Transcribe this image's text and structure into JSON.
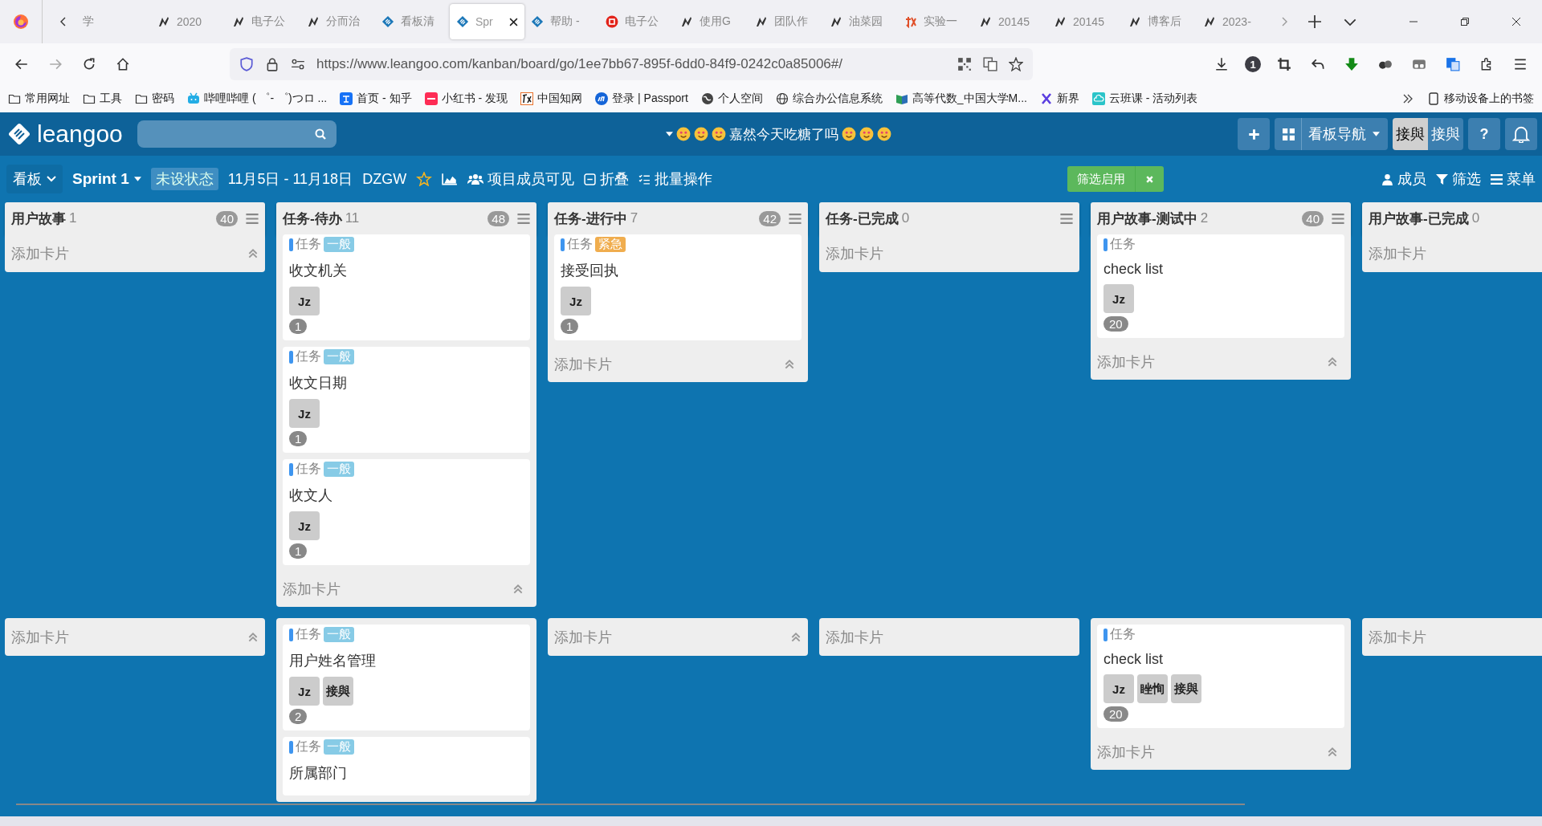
{
  "browser": {
    "tabs": [
      {
        "title": "学",
        "kind": "none",
        "selected": false
      },
      {
        "title": "2020",
        "kind": "bird",
        "selected": false
      },
      {
        "title": "电子公",
        "kind": "bird",
        "selected": false
      },
      {
        "title": "分而治",
        "kind": "bird",
        "selected": false
      },
      {
        "title": "看板清",
        "kind": "diamond",
        "selected": false
      },
      {
        "title": "Spr",
        "kind": "diamond",
        "selected": true
      },
      {
        "title": "帮助 -",
        "kind": "diamond",
        "selected": false
      },
      {
        "title": "电子公",
        "kind": "ring",
        "selected": false
      },
      {
        "title": "使用G",
        "kind": "bird",
        "selected": false
      },
      {
        "title": "团队作",
        "kind": "bird",
        "selected": false
      },
      {
        "title": "油菜园",
        "kind": "bird",
        "selected": false
      },
      {
        "title": "实验一",
        "kind": "find",
        "selected": false
      },
      {
        "title": "20145",
        "kind": "bird",
        "selected": false
      },
      {
        "title": "20145",
        "kind": "bird",
        "selected": false
      },
      {
        "title": "博客后",
        "kind": "bird",
        "selected": false
      },
      {
        "title": "2023-",
        "kind": "bird",
        "selected": false
      }
    ],
    "url": "https://www.leangoo.com/kanban/board/go/1ee7bb67-895f-6dd0-84f9-0242c0a85006#/",
    "toolbar_badge": "1",
    "bookmarks": [
      {
        "label": "常用网址",
        "kind": "folder"
      },
      {
        "label": "工具",
        "kind": "folder"
      },
      {
        "label": "密码",
        "kind": "folder"
      },
      {
        "label": "哔哩哔哩 ( ゜- ゜)つロ ...",
        "kind": "tv"
      },
      {
        "label": "首页 - 知乎",
        "kind": "zhihu"
      },
      {
        "label": "小红书 - 发现",
        "kind": "redbook"
      },
      {
        "label": "中国知网",
        "kind": "cnki"
      },
      {
        "label": "登录 | Passport",
        "kind": "passport"
      },
      {
        "label": "个人空间",
        "kind": "globedark"
      },
      {
        "label": "综合办公信息系统",
        "kind": "globe"
      },
      {
        "label": "高等代数_中国大学M...",
        "kind": "book"
      },
      {
        "label": "新界",
        "kind": "x"
      },
      {
        "label": "云班课 - 活动列表",
        "kind": "cloud"
      }
    ],
    "mobile_bookmarks": "移动设备上的书签"
  },
  "app": {
    "logo": "leangoo",
    "board_title": "嘉然今天吃糖了吗",
    "nav_label": "看板导航",
    "user_buttons": [
      {
        "label": "接與",
        "selected": true
      },
      {
        "label": "接與",
        "selected": false
      }
    ],
    "help": "?"
  },
  "board_bar": {
    "view": "看板",
    "sprint": "Sprint 1",
    "status": "未设状态",
    "dates": "11月5日 - 11月18日",
    "code": "DZGW",
    "visibility": "项目成员可见",
    "fold": "折叠",
    "batch": "批量操作",
    "filter_badge": "筛选启用",
    "members": "成员",
    "filter": "筛选",
    "menu": "菜单"
  },
  "columns": [
    {
      "title": "用户故事",
      "count": "1",
      "wip": "40",
      "menu": true
    },
    {
      "title": "任务-待办",
      "count": "11",
      "wip": "48",
      "menu": true
    },
    {
      "title": "任务-进行中",
      "count": "7",
      "wip": "42",
      "menu": true
    },
    {
      "title": "任务-已完成",
      "count": "0",
      "menu": true
    },
    {
      "title": "用户故事-测试中",
      "count": "2",
      "wip": "40",
      "menu": true
    },
    {
      "title": "用户故事-已完成",
      "count": "0",
      "menu": false
    }
  ],
  "lanes": [
    {
      "cells": [
        {
          "add_card": {
            "label": "添加卡片",
            "collapsible": true
          }
        },
        {
          "cards": [
            {
              "type": "任务",
              "tag": {
                "text": "一般",
                "color": "#87cbe6"
              },
              "title": "收文机关",
              "members": [
                "Jz"
              ],
              "count": "1"
            },
            {
              "type": "任务",
              "tag": {
                "text": "一般",
                "color": "#87cbe6"
              },
              "title": "收文日期",
              "members": [
                "Jz"
              ],
              "count": "1"
            },
            {
              "type": "任务",
              "tag": {
                "text": "一般",
                "color": "#87cbe6"
              },
              "title": "收文人",
              "members": [
                "Jz"
              ],
              "count": "1"
            }
          ],
          "add_card": {
            "label": "添加卡片",
            "collapsible": true
          }
        },
        {
          "cards": [
            {
              "type": "任务",
              "tag": {
                "text": "紧急",
                "color": "#f0ad4e"
              },
              "title": "接受回执",
              "members": [
                "Jz"
              ],
              "count": "1"
            }
          ],
          "add_card": {
            "label": "添加卡片",
            "collapsible": true
          }
        },
        {
          "add_card": {
            "label": "添加卡片",
            "collapsible": false
          }
        },
        {
          "cards": [
            {
              "type": "任务",
              "title": "check list",
              "members": [
                "Jz"
              ],
              "count": "20"
            }
          ],
          "add_card": {
            "label": "添加卡片",
            "collapsible": true
          }
        },
        {
          "add_card": {
            "label": "添加卡片",
            "collapsible": false
          }
        }
      ]
    },
    {
      "cells": [
        {
          "add_card": {
            "label": "添加卡片",
            "collapsible": true
          }
        },
        {
          "cards": [
            {
              "type": "任务",
              "tag": {
                "text": "一般",
                "color": "#87cbe6"
              },
              "title": "用户姓名管理",
              "members": [
                "Jz",
                "接與"
              ],
              "count": "2"
            },
            {
              "type": "任务",
              "tag": {
                "text": "一般",
                "color": "#87cbe6"
              },
              "title": "所属部门"
            }
          ]
        },
        {
          "add_card": {
            "label": "添加卡片",
            "collapsible": true
          }
        },
        {
          "add_card": {
            "label": "添加卡片",
            "collapsible": false
          }
        },
        {
          "cards": [
            {
              "type": "任务",
              "title": "check list",
              "members": [
                "Jz",
                "睉恂",
                "接與"
              ],
              "count": "20"
            }
          ],
          "add_card": {
            "label": "添加卡片",
            "collapsible": true
          }
        },
        {
          "add_card": {
            "label": "添加卡片",
            "collapsible": false
          }
        }
      ]
    }
  ]
}
